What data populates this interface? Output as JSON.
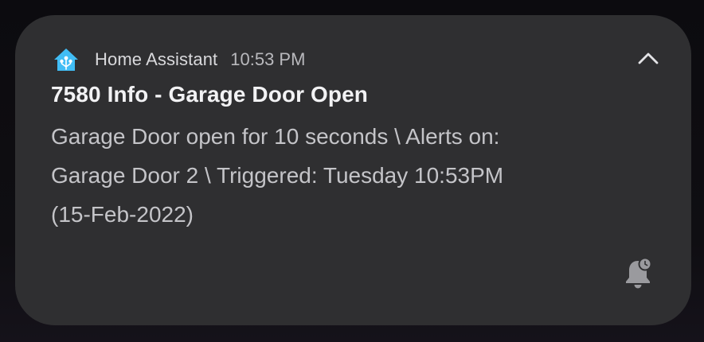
{
  "notification": {
    "app_name": "Home Assistant",
    "time": "10:53 PM",
    "title": "7580 Info - Garage Door Open",
    "body": "Garage Door open for 10 seconds \\ Alerts on:\nGarage Door 2 \\ Triggered: Tuesday 10:53PM\n(15-Feb-2022)",
    "app_icon": "home-assistant-icon",
    "collapse_icon": "chevron-up-icon",
    "bell_icon": "snooze-bell-icon"
  },
  "colors": {
    "card_background": "#2f2f31",
    "app_icon": "#41bdf5",
    "title_text": "#f2f2f4",
    "body_text": "#c4c4c8"
  }
}
